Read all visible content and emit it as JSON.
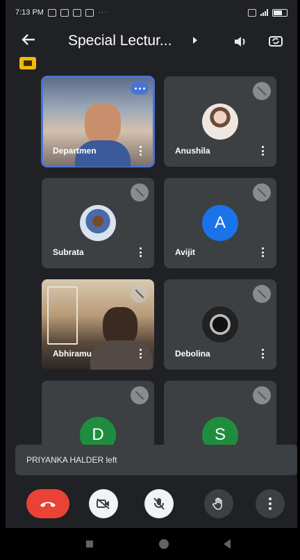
{
  "status": {
    "time": "7:13 PM",
    "more": "···"
  },
  "header": {
    "title": "Special Lectur...",
    "back_icon": "arrow-left-icon",
    "speaker_icon": "speaker-icon",
    "switch_camera_icon": "switch-camera-icon"
  },
  "participants": [
    {
      "name": "Departmen",
      "type": "video",
      "muted": false,
      "active": true
    },
    {
      "name": "Anushila",
      "type": "photo",
      "muted": true
    },
    {
      "name": "Subrata",
      "type": "photo",
      "muted": true
    },
    {
      "name": "Avijit",
      "type": "letter",
      "letter": "A",
      "color": "#1a73e8",
      "muted": true
    },
    {
      "name": "Abhiramu",
      "type": "video",
      "muted": true
    },
    {
      "name": "Debolina",
      "type": "photo",
      "muted": true
    },
    {
      "name": "",
      "type": "letter",
      "letter": "D",
      "color": "#1e8e3e",
      "muted": true
    },
    {
      "name": "",
      "type": "letter",
      "letter": "S",
      "color": "#1e8e3e",
      "muted": true
    }
  ],
  "toast": {
    "message": "PRIYANKA HALDER left"
  },
  "controls": {
    "end_call_icon": "end-call-icon",
    "camera_off_icon": "camera-off-icon",
    "mic_off_icon": "mic-off-icon",
    "raise_hand_icon": "raise-hand-icon",
    "more_icon": "more-vertical-icon",
    "end_call_color": "#ea4335"
  }
}
